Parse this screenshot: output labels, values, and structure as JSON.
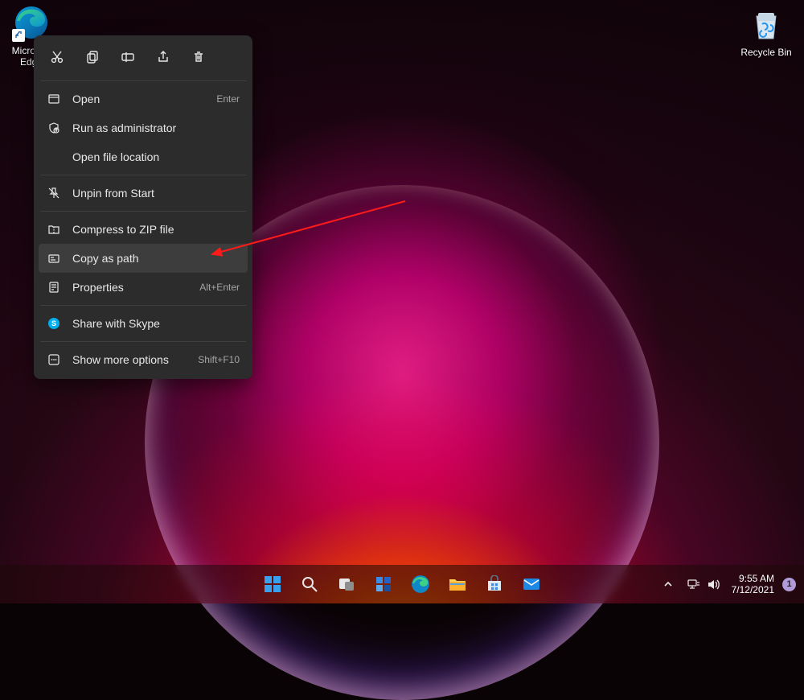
{
  "desktop": {
    "edge_label": "Microsoft Edge",
    "recycle_label": "Recycle Bin"
  },
  "context_menu": {
    "iconbar": {
      "cut": "cut-icon",
      "copy": "copy-icon",
      "rename": "rename-icon",
      "share": "share-icon",
      "delete": "delete-icon"
    },
    "items": [
      {
        "icon": "open-icon",
        "label": "Open",
        "hotkey": "Enter"
      },
      {
        "icon": "admin-icon",
        "label": "Run as administrator",
        "hotkey": ""
      },
      {
        "icon": "",
        "label": "Open file location",
        "hotkey": ""
      },
      {
        "sep": true
      },
      {
        "icon": "unpin-icon",
        "label": "Unpin from Start",
        "hotkey": ""
      },
      {
        "sep": true
      },
      {
        "icon": "zip-icon",
        "label": "Compress to ZIP file",
        "hotkey": ""
      },
      {
        "icon": "copypath-icon",
        "label": "Copy as path",
        "hotkey": "",
        "highlight": true
      },
      {
        "icon": "properties-icon",
        "label": "Properties",
        "hotkey": "Alt+Enter"
      },
      {
        "sep": true
      },
      {
        "icon": "skype-icon",
        "label": "Share with Skype",
        "hotkey": ""
      },
      {
        "sep": true
      },
      {
        "icon": "more-icon",
        "label": "Show more options",
        "hotkey": "Shift+F10"
      }
    ]
  },
  "taskbar": {
    "time": "9:55 AM",
    "date": "7/12/2021",
    "notif_count": "1"
  }
}
